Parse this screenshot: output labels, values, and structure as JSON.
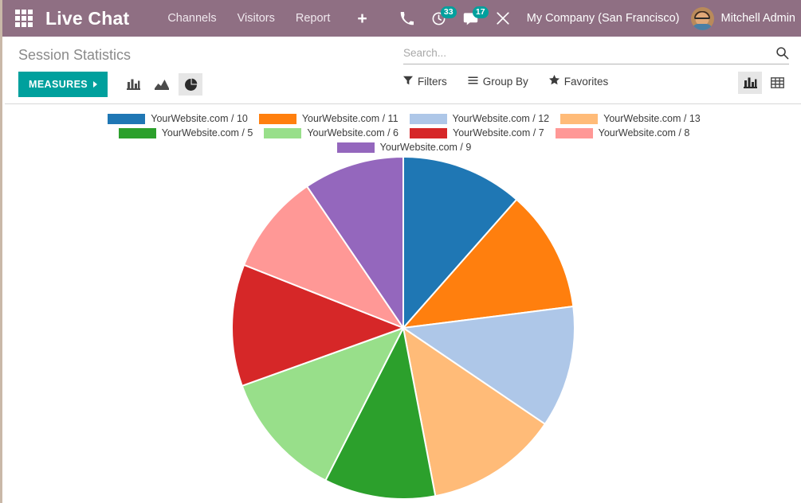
{
  "navbar": {
    "apps_icon": "apps-grid-icon",
    "brand": "Live Chat",
    "menu": [
      {
        "label": "Channels"
      },
      {
        "label": "Visitors"
      },
      {
        "label": "Report"
      }
    ],
    "new_label": "+",
    "sys_icons": [
      {
        "name": "phone-icon",
        "badge": null
      },
      {
        "name": "activity-clock-icon",
        "badge": "33"
      },
      {
        "name": "messages-icon",
        "badge": "17"
      },
      {
        "name": "developer-tools-icon",
        "badge": null
      }
    ],
    "company": "My Company (San Francisco)",
    "user_name": "Mitchell Admin",
    "accent_bar": "#8f6f83",
    "badge_color": "#00a09d"
  },
  "control_panel": {
    "title": "Session Statistics",
    "measures_label": "MEASURES",
    "measures_color": "#00a09d",
    "chart_buttons": [
      {
        "name": "bar-chart-icon",
        "active": false
      },
      {
        "name": "line-chart-icon",
        "active": false
      },
      {
        "name": "pie-chart-icon",
        "active": true
      }
    ],
    "search": {
      "placeholder": "Search...",
      "value": ""
    },
    "filters": [
      {
        "label": "Filters",
        "icon": "funnel-icon"
      },
      {
        "label": "Group By",
        "icon": "hamburger-icon"
      },
      {
        "label": "Favorites",
        "icon": "star-icon"
      }
    ],
    "view_toggles": [
      {
        "name": "graph-view-icon",
        "active": true
      },
      {
        "name": "list-view-icon",
        "active": false
      }
    ]
  },
  "chart_data": {
    "type": "pie",
    "title": "Session Statistics",
    "legend_position": "top",
    "labels": [
      "YourWebsite.com / 10",
      "YourWebsite.com / 11",
      "YourWebsite.com / 12",
      "YourWebsite.com / 13",
      "YourWebsite.com / 5",
      "YourWebsite.com / 6",
      "YourWebsite.com / 7",
      "YourWebsite.com / 8",
      "YourWebsite.com / 9"
    ],
    "values": [
      11.5,
      11.5,
      11.5,
      12.5,
      10.5,
      12.0,
      11.5,
      9.5,
      9.5
    ],
    "colors": [
      "#1f77b4",
      "#ff7f0e",
      "#aec7e8",
      "#ffbb78",
      "#2ca02c",
      "#98df8a",
      "#d62728",
      "#ff9896",
      "#9467bd"
    ]
  }
}
